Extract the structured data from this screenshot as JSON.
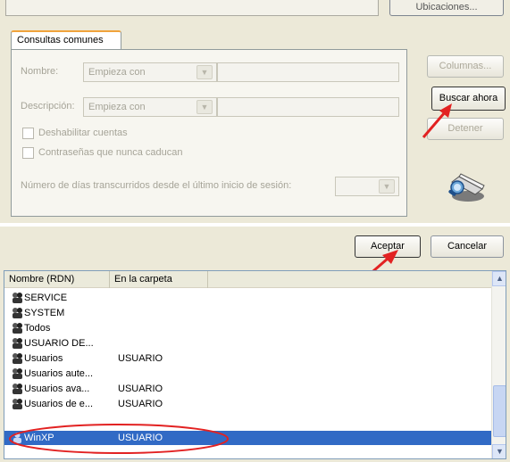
{
  "top": {
    "top_button_label": "Ubicaciones...",
    "tab_label": "Consultas comunes",
    "name_label": "Nombre:",
    "name_combo_value": "Empieza con",
    "desc_label": "Descripción:",
    "desc_combo_value": "Empieza con",
    "chk_disabled_accounts": "Deshabilitar cuentas",
    "chk_no_expire": "Contraseñas que nunca caducan",
    "days_label": "Número de días transcurridos desde el último inicio de sesión:",
    "btn_columns": "Columnas...",
    "btn_search_now": "Buscar ahora",
    "btn_stop": "Detener"
  },
  "bottom": {
    "btn_accept": "Aceptar",
    "btn_cancel": "Cancelar",
    "columns": [
      "Nombre (RDN)",
      "En la carpeta"
    ],
    "rows": [
      {
        "name": "SERVICE",
        "folder": ""
      },
      {
        "name": "SYSTEM",
        "folder": ""
      },
      {
        "name": "Todos",
        "folder": ""
      },
      {
        "name": "USUARIO DE...",
        "folder": ""
      },
      {
        "name": "Usuarios",
        "folder": "USUARIO"
      },
      {
        "name": "Usuarios aute...",
        "folder": ""
      },
      {
        "name": "Usuarios ava...",
        "folder": "USUARIO"
      },
      {
        "name": "Usuarios de e...",
        "folder": "USUARIO"
      },
      {
        "name": "WinXP",
        "folder": "USUARIO",
        "selected": true
      }
    ]
  },
  "colors": {
    "highlight_red": "#e22222",
    "selection_blue": "#316ac5"
  },
  "icons": [
    "user-group-icon",
    "search-people-icon",
    "red-arrow-icon"
  ]
}
